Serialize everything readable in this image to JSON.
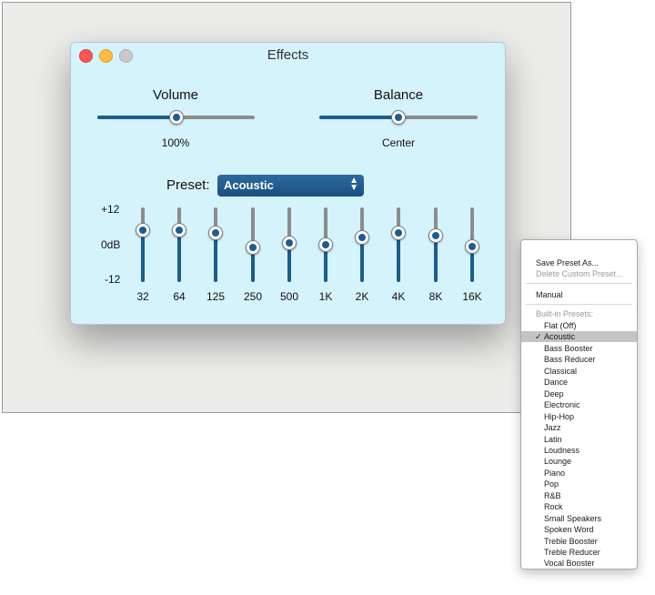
{
  "window": {
    "title": "Effects"
  },
  "volume": {
    "label": "Volume",
    "value_text": "100%",
    "level": 0.5
  },
  "balance": {
    "label": "Balance",
    "value_text": "Center",
    "level": 0.5
  },
  "preset": {
    "label": "Preset:",
    "selected": "Acoustic"
  },
  "eq": {
    "scale_top": "+12",
    "scale_mid": "0dB",
    "scale_bottom": "-12",
    "bands": [
      {
        "freq": "32",
        "level": 0.7
      },
      {
        "freq": "64",
        "level": 0.7
      },
      {
        "freq": "125",
        "level": 0.66
      },
      {
        "freq": "250",
        "level": 0.46
      },
      {
        "freq": "500",
        "level": 0.52
      },
      {
        "freq": "1K",
        "level": 0.5
      },
      {
        "freq": "2K",
        "level": 0.6
      },
      {
        "freq": "4K",
        "level": 0.66
      },
      {
        "freq": "8K",
        "level": 0.62
      },
      {
        "freq": "16K",
        "level": 0.48
      }
    ]
  },
  "menu": {
    "save_preset": "Save Preset As...",
    "delete_preset": "Delete Custom Preset...",
    "manual": "Manual",
    "builtin_header": "Built-in Presets:",
    "check_mark": "✓",
    "presets": [
      "Flat (Off)",
      "Acoustic",
      "Bass Booster",
      "Bass Reducer",
      "Classical",
      "Dance",
      "Deep",
      "Electronic",
      "Hip-Hop",
      "Jazz",
      "Latin",
      "Loudness",
      "Lounge",
      "Piano",
      "Pop",
      "R&B",
      "Rock",
      "Small Speakers",
      "Spoken Word",
      "Treble Booster",
      "Treble Reducer",
      "Vocal Booster"
    ],
    "selected_index": 1
  },
  "colors": {
    "window_bg": "#d5f3fb",
    "accent": "#1c5d90",
    "track": "#8c8c8c",
    "close": "#fc5753",
    "minimize": "#fdbc40",
    "zoom": "#c9c9c9",
    "menu_highlight": "#c4c4c4"
  }
}
